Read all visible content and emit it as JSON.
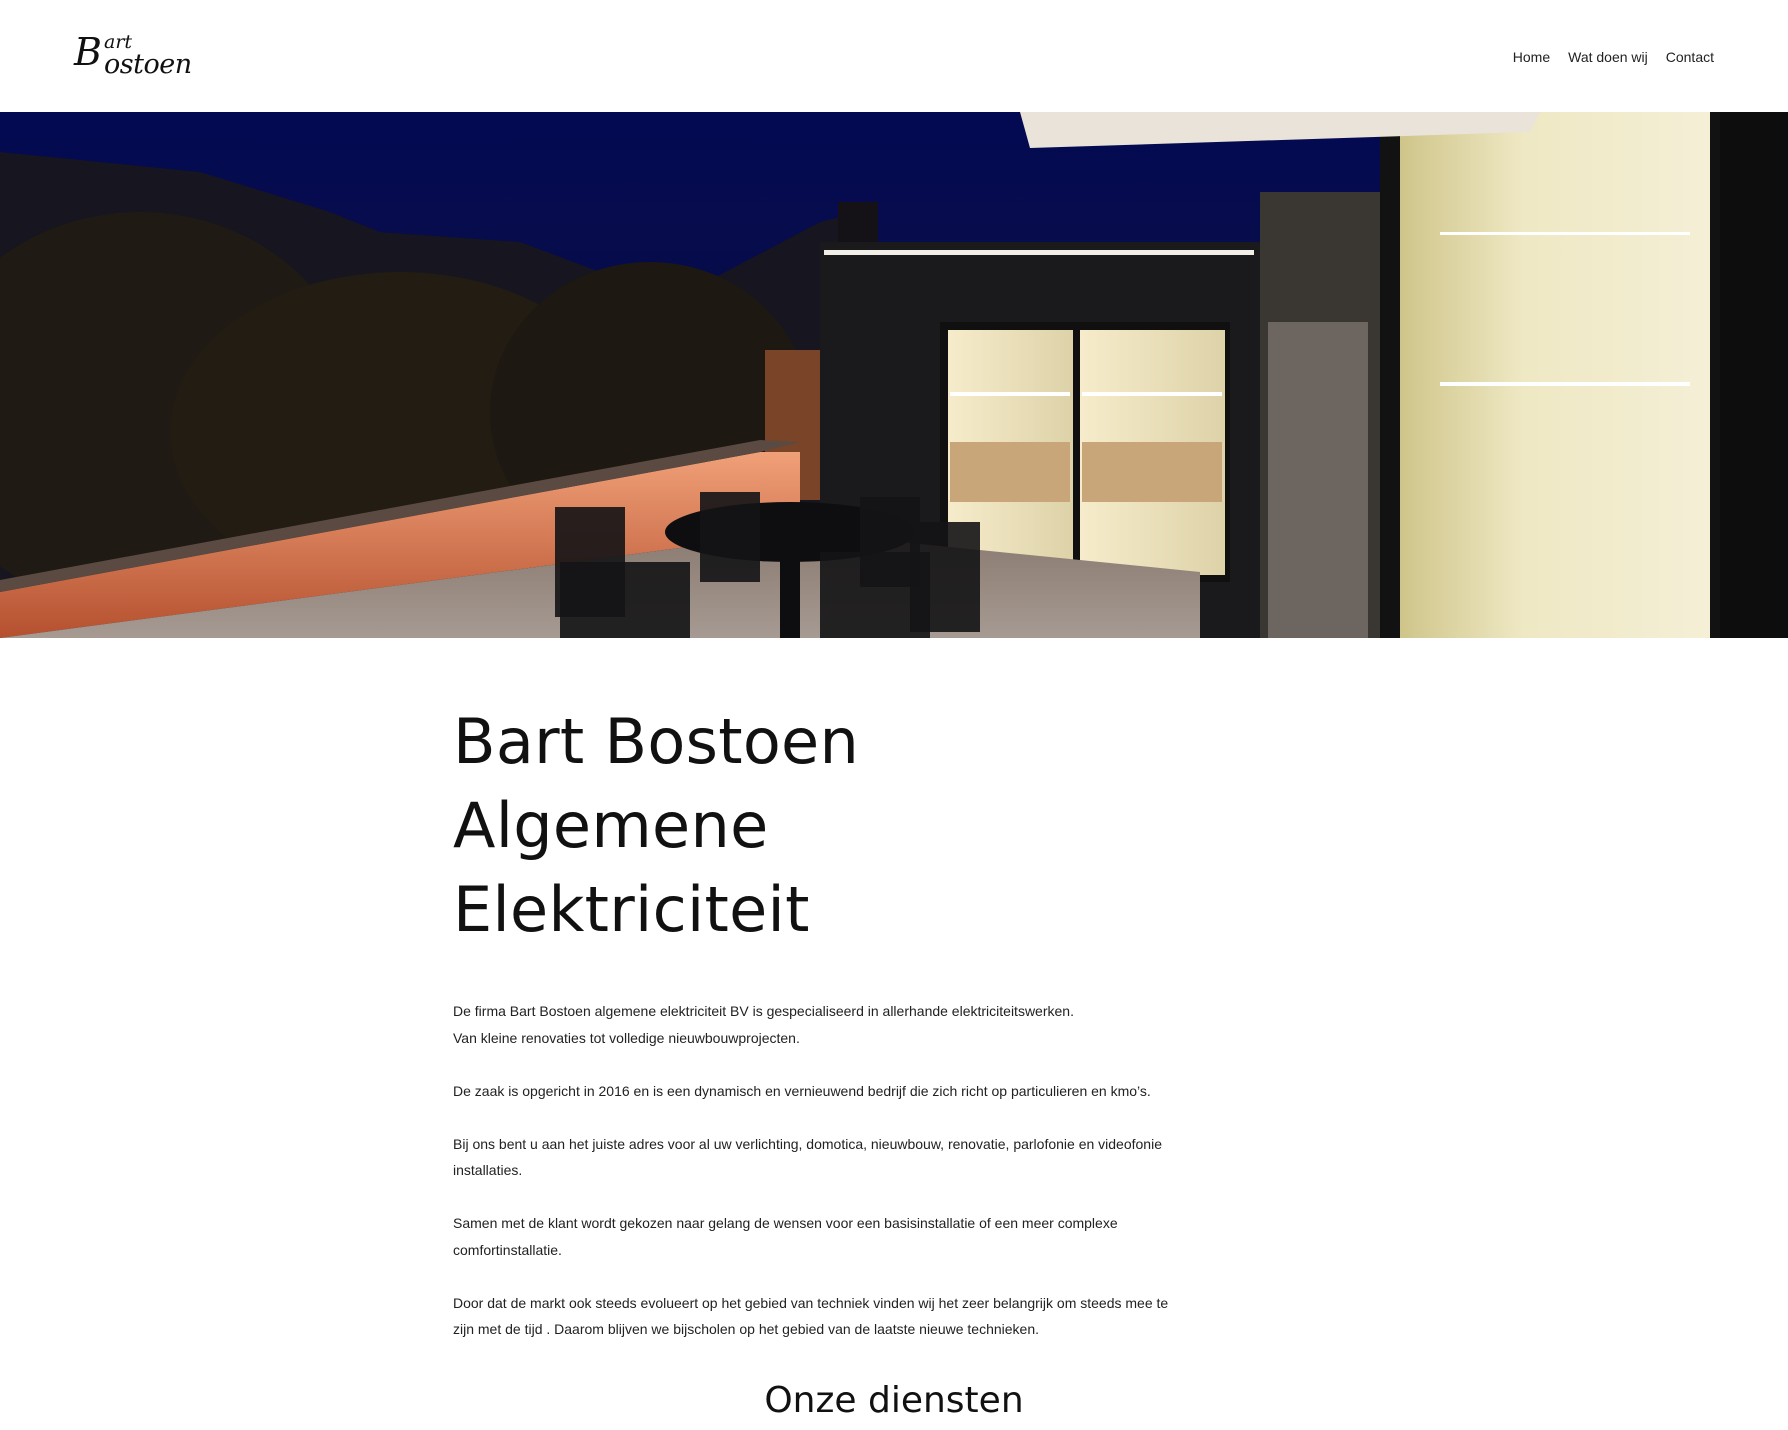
{
  "header": {
    "logo": {
      "top": "art",
      "initial": "B",
      "rest": "ostoen"
    },
    "nav": [
      {
        "label": "Home"
      },
      {
        "label": "Wat doen wij"
      },
      {
        "label": "Contact"
      }
    ]
  },
  "main": {
    "title_line1": "Bart Bostoen Algemene",
    "title_line2": "Elektriciteit",
    "paragraphs": [
      "De firma Bart Bostoen algemene elektriciteit BV is gespecialiseerd in allerhande elektriciteitswerken.\nVan kleine renovaties tot volledige nieuwbouwprojecten.",
      "De zaak is opgericht in 2016 en is een dynamisch en vernieuwend bedrijf die zich richt op particulieren en kmo’s.",
      "Bij ons bent u aan het juiste adres voor al uw verlichting, domotica, nieuwbouw, renovatie, parlofonie en videofonie\ninstallaties.",
      "Samen met de klant wordt gekozen naar gelang de wensen voor een basisinstallatie of een meer complexe\ncomfortinstallatie.",
      "Door dat de markt ook steeds evolueert op het gebied van techniek vinden wij het zeer belangrijk om steeds mee te\nzijn met de tijd . Daarom blijven we bijscholen op het gebied van de laatste nieuwe technieken."
    ]
  },
  "services": {
    "title": "Onze diensten"
  }
}
